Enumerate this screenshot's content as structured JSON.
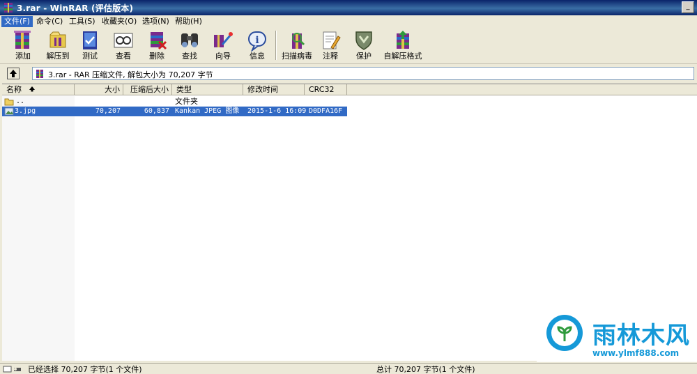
{
  "window": {
    "title": "3.rar - WinRAR (评估版本)"
  },
  "menu": [
    {
      "label": "文件(F)"
    },
    {
      "label": "命令(C)"
    },
    {
      "label": "工具(S)"
    },
    {
      "label": "收藏夹(O)"
    },
    {
      "label": "选项(N)"
    },
    {
      "label": "帮助(H)"
    }
  ],
  "toolbar": [
    {
      "label": "添加",
      "icon": "add-archive-icon"
    },
    {
      "label": "解压到",
      "icon": "extract-to-icon"
    },
    {
      "label": "测试",
      "icon": "test-icon"
    },
    {
      "label": "查看",
      "icon": "view-icon"
    },
    {
      "label": "删除",
      "icon": "delete-icon"
    },
    {
      "label": "查找",
      "icon": "find-icon"
    },
    {
      "label": "向导",
      "icon": "wizard-icon"
    },
    {
      "label": "信息",
      "icon": "info-icon"
    },
    {
      "label": "扫描病毒",
      "icon": "virus-scan-icon"
    },
    {
      "label": "注释",
      "icon": "comment-icon"
    },
    {
      "label": "保护",
      "icon": "protect-icon"
    },
    {
      "label": "自解压格式",
      "icon": "sfx-icon"
    }
  ],
  "address": {
    "text": "3.rar - RAR 压缩文件, 解包大小为 70,207 字节"
  },
  "columns": [
    {
      "label": "名称"
    },
    {
      "label": "大小"
    },
    {
      "label": "压缩后大小"
    },
    {
      "label": "类型"
    },
    {
      "label": "修改时间"
    },
    {
      "label": "CRC32"
    }
  ],
  "rows": [
    {
      "name": "..",
      "size": "",
      "packed": "",
      "type": "文件夹",
      "modified": "",
      "crc": "",
      "icon": "folder-icon",
      "selected": false
    },
    {
      "name": "3.jpg",
      "size": "70,207",
      "packed": "60,837",
      "type": "Kankan JPEG 图像",
      "modified": "2015-1-6 16:09",
      "crc": "D0DFA16F",
      "icon": "jpg-file-icon",
      "selected": true
    }
  ],
  "status": {
    "left": "已经选择 70,207 字节(1 个文件)",
    "right": "总计 70,207 字节(1 个文件)"
  },
  "watermark": {
    "brand": "雨林木风",
    "url": "www.ylmf888.com"
  },
  "colors": {
    "titlebar": "#0a246a",
    "selection": "#316ac5",
    "brand": "#1599d8"
  }
}
